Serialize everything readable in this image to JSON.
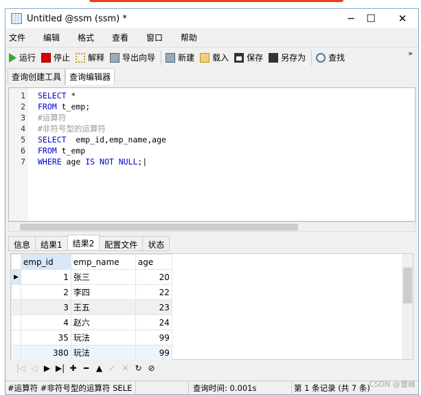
{
  "window": {
    "title": "Untitled @ssm (ssm) *",
    "minimize": "─",
    "maximize": "☐",
    "close": "✕"
  },
  "menu": [
    "文件",
    "编辑",
    "格式",
    "查看",
    "窗口",
    "帮助"
  ],
  "toolbar": {
    "run": "运行",
    "stop": "停止",
    "explain": "解释",
    "export": "导出向导",
    "new": "新建",
    "load": "载入",
    "save": "保存",
    "save_as": "另存为",
    "find": "查找",
    "more": "»"
  },
  "tabs": [
    "查询创建工具",
    "查询编辑器"
  ],
  "editor": {
    "line_numbers": [
      "1",
      "2",
      "3",
      "4",
      "5",
      "6",
      "7"
    ]
  },
  "result_tabs": [
    "信息",
    "结果1",
    "结果2",
    "配置文件",
    "状态"
  ],
  "grid": {
    "columns": [
      "emp_id",
      "emp_name",
      "age"
    ],
    "rows": [
      [
        "1",
        "张三",
        "20"
      ],
      [
        "2",
        "李四",
        "22"
      ],
      [
        "3",
        "王五",
        "23"
      ],
      [
        "4",
        "赵六",
        "24"
      ],
      [
        "35",
        "玩法",
        "99"
      ],
      [
        "380",
        "玩法",
        "99"
      ]
    ]
  },
  "nav": [
    "|◁",
    "◁",
    "▶",
    "▶|",
    "✚",
    "━",
    "▲",
    "✓",
    "✕",
    "↻",
    "⊘"
  ],
  "status": {
    "sql": "#运算符 #非符号型的运算符 SELE",
    "time": "查询时间: 0.001s",
    "record": "第 1 条记录 (共 7 条)"
  },
  "watermark": "CSDN @蕾峰"
}
